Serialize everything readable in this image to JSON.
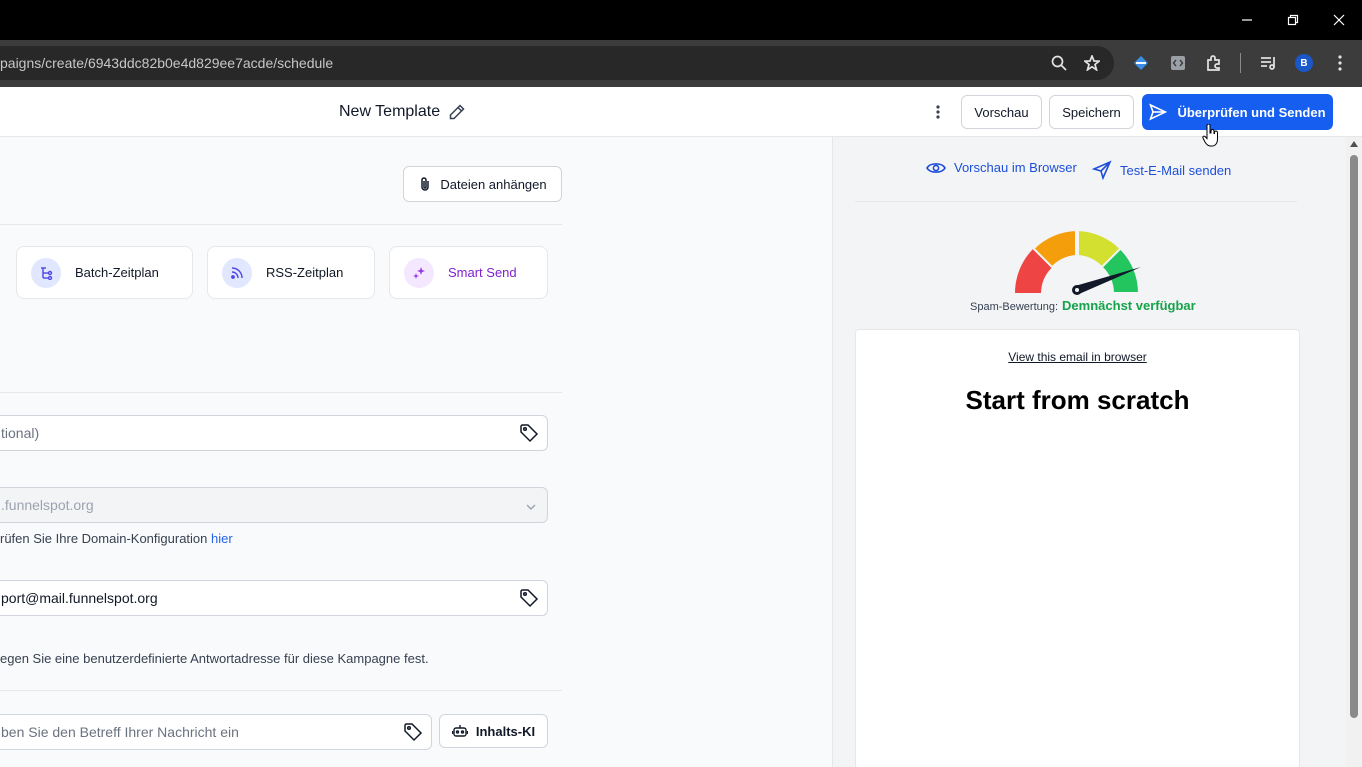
{
  "browser": {
    "url": "paigns/create/6943ddc82b0e4d829ee7acde/schedule",
    "profile_initial": "B"
  },
  "header": {
    "template_title": "New Template",
    "preview_label": "Vorschau",
    "save_label": "Speichern",
    "review_send_label": "Überprüfen und Senden"
  },
  "left": {
    "attach_label": "Dateien anhängen",
    "schedule_options": [
      {
        "label": "Batch-Zeitplan"
      },
      {
        "label": "RSS-Zeitplan"
      },
      {
        "label": "Smart Send"
      }
    ],
    "tag_field_placeholder": "tional)",
    "domain_field_value": ".funnelspot.org",
    "domain_helper": "rüfen Sie Ihre Domain-Konfiguration ",
    "domain_helper_link": "hier",
    "reply_field_value": "port@mail.funnelspot.org",
    "reply_helper": "egen Sie eine benutzerdefinierte Antwortadresse für diese Kampagne fest.",
    "subject_placeholder": "ben Sie den Betreff Ihrer Nachricht ein",
    "content_ai_label": "Inhalts-KI"
  },
  "right": {
    "browser_preview_label": "Vorschau im Browser",
    "test_email_label": "Test-E-Mail senden",
    "spam_label": "Spam-Bewertung:",
    "spam_value": "Demnächst verfügbar",
    "email_preview": {
      "view_link": "View this email in browser",
      "heading": "Start from scratch"
    }
  },
  "colors": {
    "primary": "#155eef",
    "link": "#1d4ed8",
    "spam_value": "#16a34a",
    "gauge": [
      "#ef4444",
      "#f59e0b",
      "#d4e030",
      "#22c55e"
    ]
  }
}
